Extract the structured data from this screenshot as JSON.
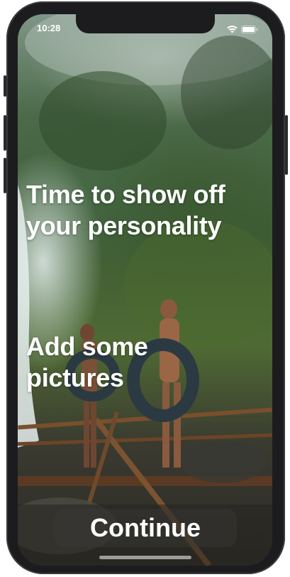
{
  "status_bar": {
    "time": "10:28",
    "icons": [
      "wifi-icon",
      "battery-icon"
    ]
  },
  "onboarding": {
    "headline": "Time to show off your personality",
    "subheadline": "Add some pictures",
    "continue_label": "Continue"
  },
  "colors": {
    "text": "#ffffff",
    "device_frame": "#1c1c1e"
  }
}
